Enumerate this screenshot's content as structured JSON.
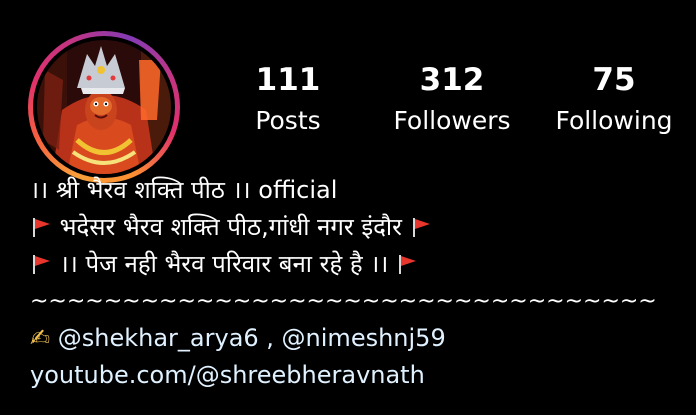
{
  "profile": {
    "avatar": "deity-profile-photo"
  },
  "stats": {
    "posts": {
      "count": "111",
      "label": "Posts"
    },
    "followers": {
      "count": "312",
      "label": "Followers"
    },
    "following": {
      "count": "75",
      "label": "Following"
    }
  },
  "bio": {
    "line1": "।। श्री भैरव शक्ति पीठ ।। official",
    "line2": "भदेसर भैरव शक्ति पीठ,गांधी नगर इंदौर",
    "line3": "।। पेज नही भैरव परिवार बना रहे है ।।",
    "divider": "~~~~~~~~~~~~~~~~~~~~~~~~~~~~~~~~~~",
    "mentions_emoji": "✍",
    "mentions": "@shekhar_arya6 , @nimeshnj59",
    "link": "youtube.com/@shreebheravnath"
  },
  "colors": {
    "background": "#000000",
    "text": "#ffffff",
    "link": "#e0f1ff",
    "flag": "#e8362d"
  },
  "icons": {
    "flag": "triangular-flag-icon",
    "writing_hand": "writing-hand-icon"
  }
}
